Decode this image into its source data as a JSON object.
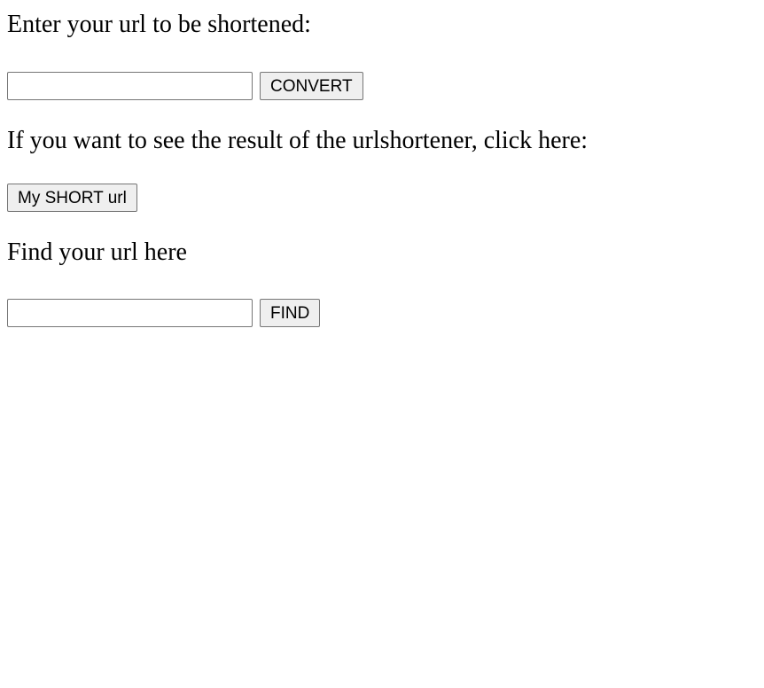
{
  "shorten": {
    "label": "Enter your url to be shortened:",
    "input_value": "",
    "input_placeholder": "",
    "button_label": "CONVERT"
  },
  "result": {
    "label": "If you want to see the result of the urlshortener, click here:",
    "button_label": "My SHORT url"
  },
  "find": {
    "label": "Find your url here",
    "input_value": "",
    "input_placeholder": "",
    "button_label": "FIND"
  }
}
